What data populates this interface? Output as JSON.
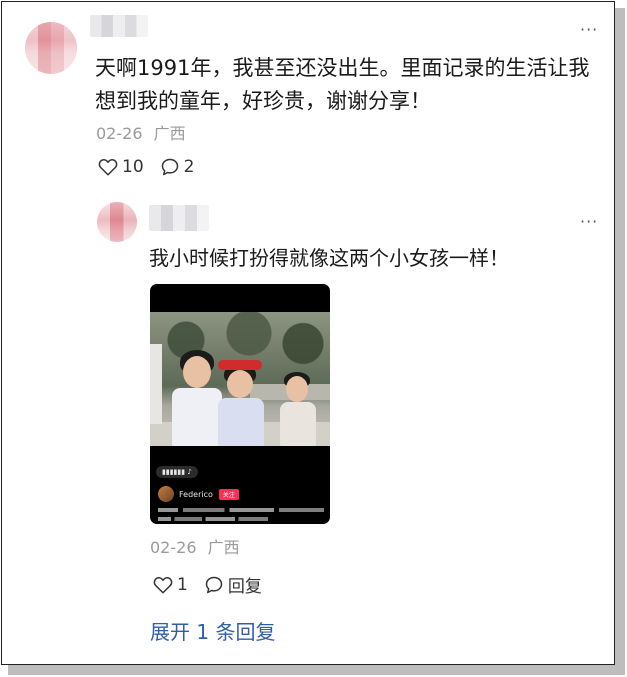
{
  "comment": {
    "text": "天啊1991年，我甚至还没出生。里面记录的生活让我想到我的童年，好珍贵，谢谢分享！",
    "date": "02-26",
    "location": "广西",
    "like_count": "10",
    "reply_count": "2",
    "more_icon": "ellipsis-icon"
  },
  "reply": {
    "text": "我小时候打扮得就像这两个小女孩一样！",
    "date": "02-26",
    "location": "广西",
    "like_count": "1",
    "reply_label": "回复",
    "more_icon": "ellipsis-icon",
    "video": {
      "creator_name": "Federico",
      "follow_label": "关注"
    }
  },
  "expand_label": "展开 1 条回复",
  "colors": {
    "link": "#2f5fa8",
    "meta": "#9a9a9a",
    "text": "#1a1a1a"
  }
}
